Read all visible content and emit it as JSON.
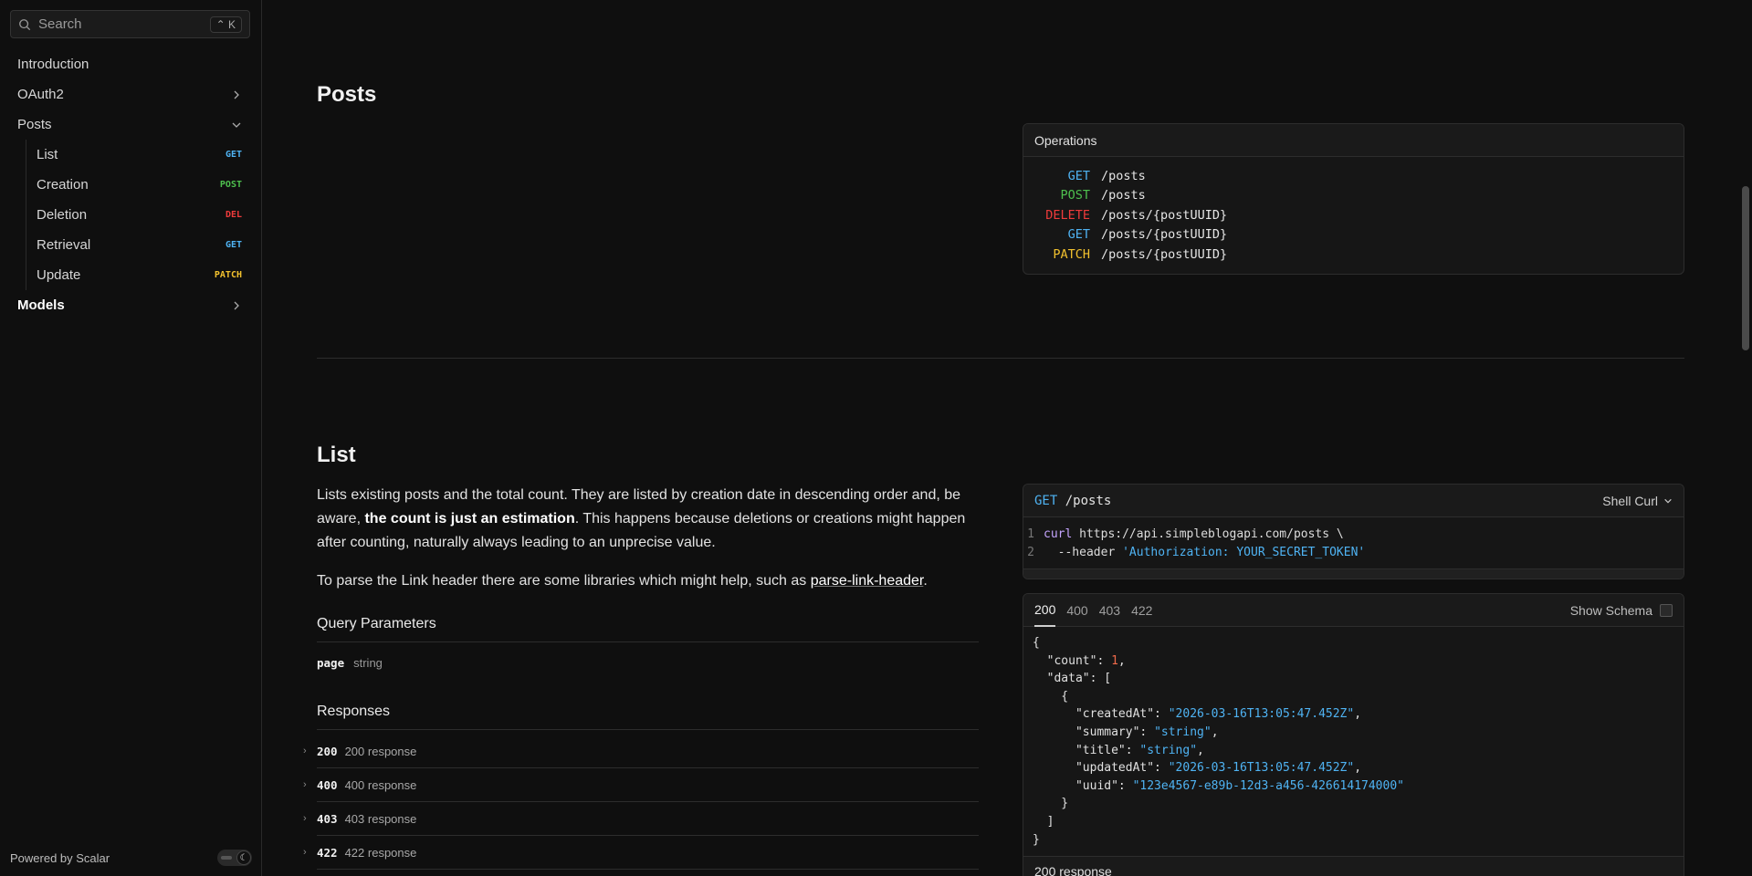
{
  "search": {
    "placeholder": "Search",
    "shortcut": "⌃ K"
  },
  "sidebar": {
    "items": [
      {
        "label": "Introduction"
      },
      {
        "label": "OAuth2"
      },
      {
        "label": "Posts"
      },
      {
        "label": "List",
        "method": "GET"
      },
      {
        "label": "Creation",
        "method": "POST"
      },
      {
        "label": "Deletion",
        "method": "DEL"
      },
      {
        "label": "Retrieval",
        "method": "GET"
      },
      {
        "label": "Update",
        "method": "PATCH"
      },
      {
        "label": "Models"
      }
    ],
    "footer": "Powered by Scalar"
  },
  "posts_section": {
    "title": "Posts",
    "operations_title": "Operations",
    "operations": [
      {
        "method": "GET",
        "path": "/posts"
      },
      {
        "method": "POST",
        "path": "/posts"
      },
      {
        "method": "DELETE",
        "path": "/posts/{postUUID}"
      },
      {
        "method": "GET",
        "path": "/posts/{postUUID}"
      },
      {
        "method": "PATCH",
        "path": "/posts/{postUUID}"
      }
    ]
  },
  "list_section": {
    "title": "List",
    "desc_part1": "Lists existing posts and the total count. They are listed by creation date in descending order and, be aware, ",
    "desc_bold": "the count is just an estimation",
    "desc_part2": ". This happens because deletions or creations might happen after counting, naturally always leading to an unprecise value.",
    "desc2_part1": "To parse the Link header there are some libraries which might help, such as ",
    "desc2_link": "parse-link-header",
    "desc2_part2": ".",
    "query_params_title": "Query Parameters",
    "param_name": "page",
    "param_type": "string",
    "responses_title": "Responses",
    "responses": [
      {
        "code": "200",
        "label": "200 response"
      },
      {
        "code": "400",
        "label": "400 response"
      },
      {
        "code": "403",
        "label": "403 response"
      },
      {
        "code": "422",
        "label": "422 response"
      }
    ]
  },
  "request_card": {
    "method": "GET",
    "path": "/posts",
    "client": "Shell Curl",
    "line1_cmd": "curl",
    "line1_url": "https://api.simpleblogapi.com/posts \\",
    "line2_flag": "--header",
    "line2_value": "'Authorization: YOUR_SECRET_TOKEN'"
  },
  "response_card": {
    "tabs": [
      "200",
      "400",
      "403",
      "422"
    ],
    "show_schema": "Show Schema",
    "json": {
      "count": "1",
      "createdAt": "\"2026-03-16T13:05:47.452Z\"",
      "summary": "\"string\"",
      "title": "\"string\"",
      "updatedAt": "\"2026-03-16T13:05:47.452Z\"",
      "uuid": "\"123e4567-e89b-12d3-a456-426614174000\""
    },
    "footer": "200 response"
  },
  "colors": {
    "get": "#4fb3f3",
    "post": "#4ec04e",
    "delete": "#ef3b3b",
    "patch": "#f2c12e"
  }
}
